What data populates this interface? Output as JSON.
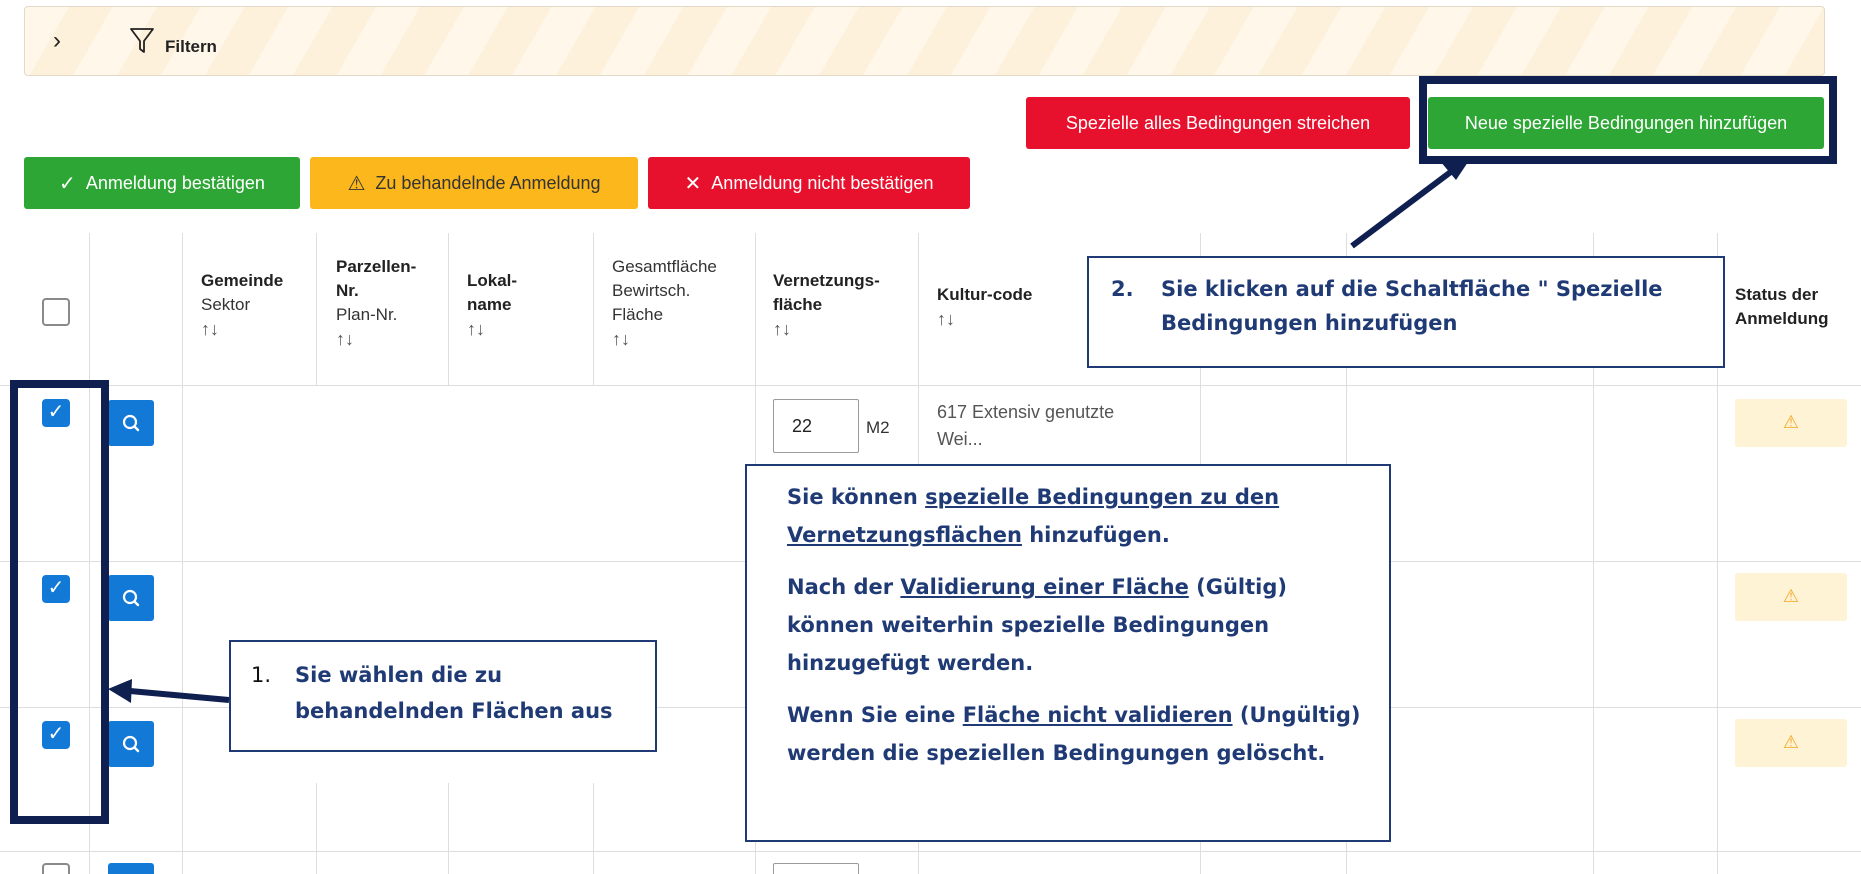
{
  "filter": {
    "label": "Filtern"
  },
  "buttons": {
    "strike_all": "Spezielle alles Bedingungen streichen",
    "add_new": "Neue spezielle Bedingungen hinzufügen",
    "confirm": "Anmeldung bestätigen",
    "to_handle": "Zu behandelnde Anmeldung",
    "not_confirm": "Anmeldung nicht bestätigen"
  },
  "table": {
    "headers": {
      "gemeinde": {
        "bold": "Gemeinde",
        "sub": "Sektor"
      },
      "parzellen": {
        "bold1": "Parzellen-",
        "bold2": "Nr.",
        "sub": "Plan-Nr."
      },
      "lokal": {
        "bold1": "Lokal-",
        "bold2": "name"
      },
      "gesamt": {
        "line1": "Gesamtfläche",
        "line2": "Bewirtsch.",
        "line3": "Fläche"
      },
      "vernetzung": {
        "bold1": "Vernetzungs-",
        "bold2": "fläche"
      },
      "kultur": {
        "bold": "Kultur-code"
      },
      "status": {
        "bold1": "Status der",
        "bold2": "Anmeldung"
      },
      "sort": "↑↓"
    },
    "row1": {
      "area_value": "22",
      "unit": "M2",
      "kultur_line1": "617 Extensiv genutzte",
      "kultur_line2": "Wei..."
    },
    "warning_symbol": "⚠"
  },
  "callouts": {
    "step1_num": "1.",
    "step1_line1": "Sie wählen die zu",
    "step1_line2": "behandelnden Flächen aus",
    "step2_num": "2.",
    "step2_line1": "Sie klicken auf die Schaltfläche \" Spezielle",
    "step2_line2": "Bedingungen hinzufügen",
    "info_p1_a": "Sie können ",
    "info_p1_u1": "spezielle Bedingungen zu den",
    "info_p1_u2": "Vernetzungsflächen",
    "info_p1_b": " hinzufügen.",
    "info_p2_a": "Nach der ",
    "info_p2_u": "Validierung einer Fläche",
    "info_p2_b": " (Gültig)",
    "info_p2_c": "können weiterhin spezielle Bedingungen",
    "info_p2_d": "hinzugefügt werden.",
    "info_p3_a": "Wenn Sie eine ",
    "info_p3_u": "Fläche nicht validieren",
    "info_p3_b": " (Ungültig)",
    "info_p3_c": "werden die speziellen Bedingungen gelöscht."
  },
  "colors": {
    "red": "#e8112d",
    "green": "#2ea636",
    "yellow": "#fbb71b",
    "blue": "#1379d6",
    "navy": "#1f3a74"
  }
}
